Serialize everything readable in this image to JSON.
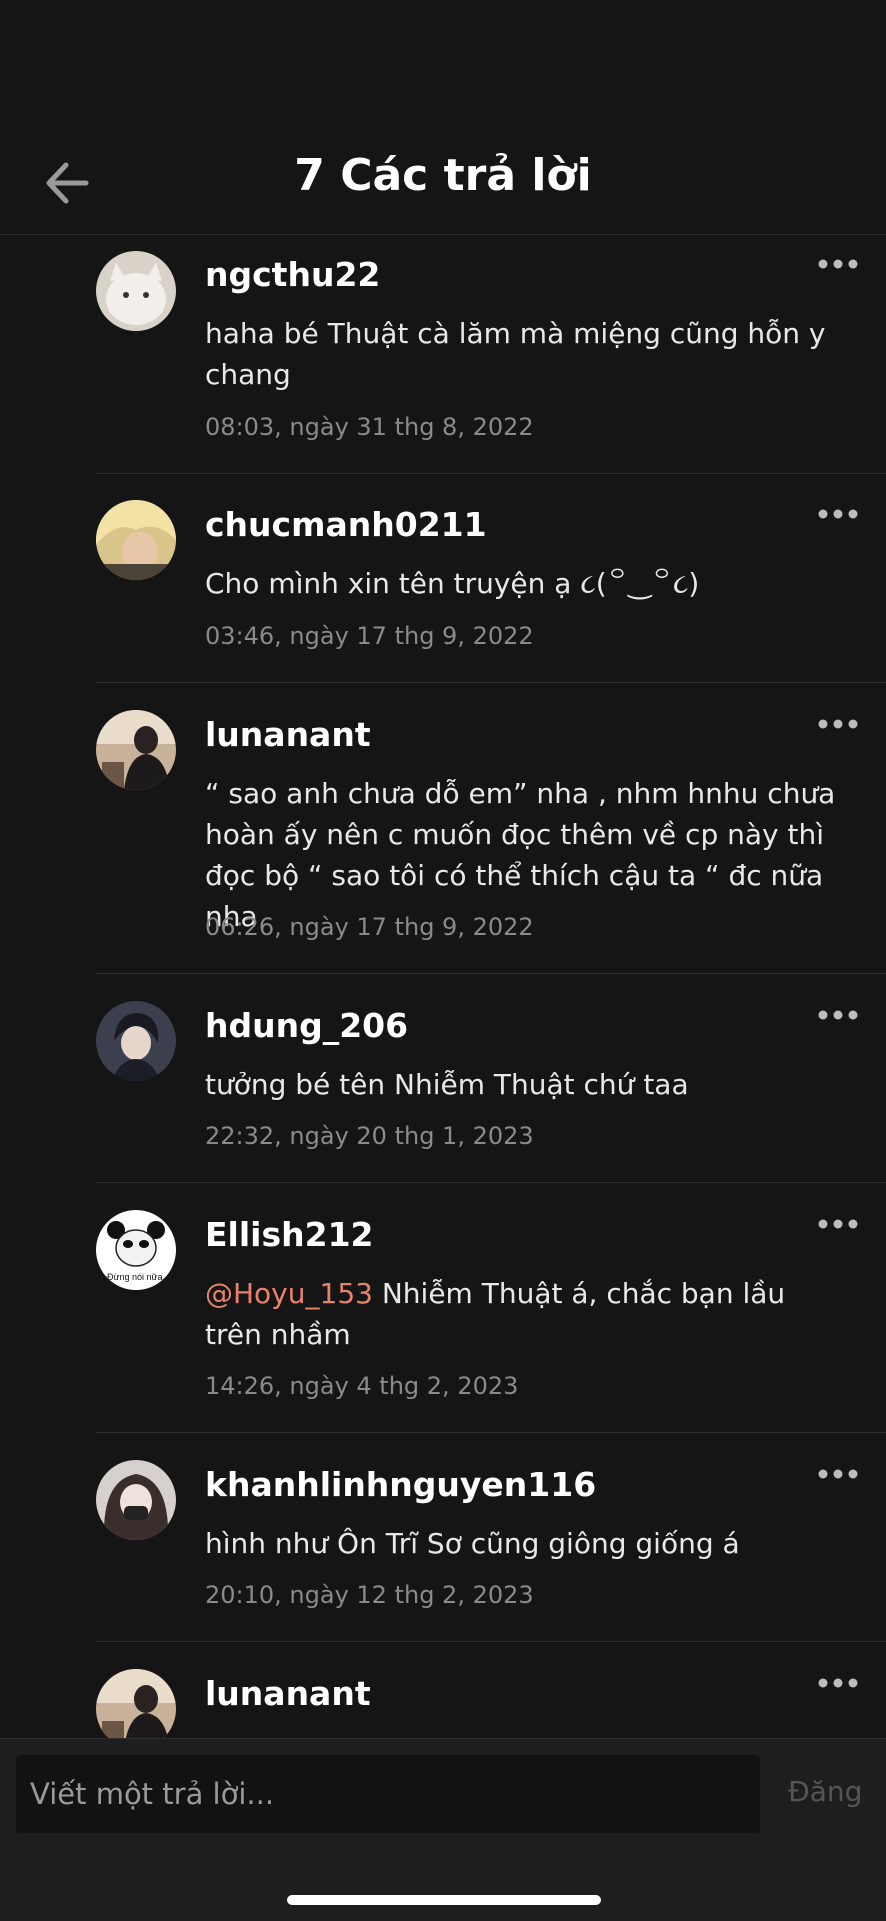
{
  "header": {
    "title": "7 Các trả lời"
  },
  "replies": [
    {
      "username": "ngcthu22",
      "text": "haha bé Thuật cà lăm mà miệng cũng hỗn y chang",
      "time": "08:03, ngày 31 thg 8, 2022"
    },
    {
      "username": "chucmanh0211",
      "text": "Cho mình xin tên truyện ạ ૮(꒪‿꒪૮)",
      "time": "03:46, ngày 17 thg 9, 2022"
    },
    {
      "username": "lunanant",
      "text": "“ sao anh chưa dỗ em” nha , nhm hnhu chưa hoàn ấy nên c muốn đọc thêm về cp này thì đọc bộ “ sao tôi có thể thích cậu ta “ đc nữa nha",
      "time": "06:26, ngày 17 thg 9, 2022"
    },
    {
      "username": "hdung_206",
      "text": "tưởng bé tên Nhiễm Thuật chứ taa",
      "time": "22:32, ngày 20 thg 1, 2023"
    },
    {
      "username": "Ellish212",
      "mention": "@Hoyu_153",
      "text": " Nhiễm Thuật á, chắc bạn lầu trên nhầm",
      "time": "14:26, ngày 4 thg 2, 2023",
      "avatar_caption": "Đừng nói nữa."
    },
    {
      "username": "khanhlinhnguyen116",
      "text": "hình như Ôn Trĩ Sơ cũng giông giống á",
      "time": "20:10, ngày 12 thg 2, 2023"
    },
    {
      "username": "lunanant"
    }
  ],
  "composer": {
    "placeholder": "Viết một trả lời...",
    "post_label": "Đăng"
  },
  "colors": {
    "background": "#151515",
    "mention": "#e8826a",
    "timestamp": "#8a8a8a"
  }
}
